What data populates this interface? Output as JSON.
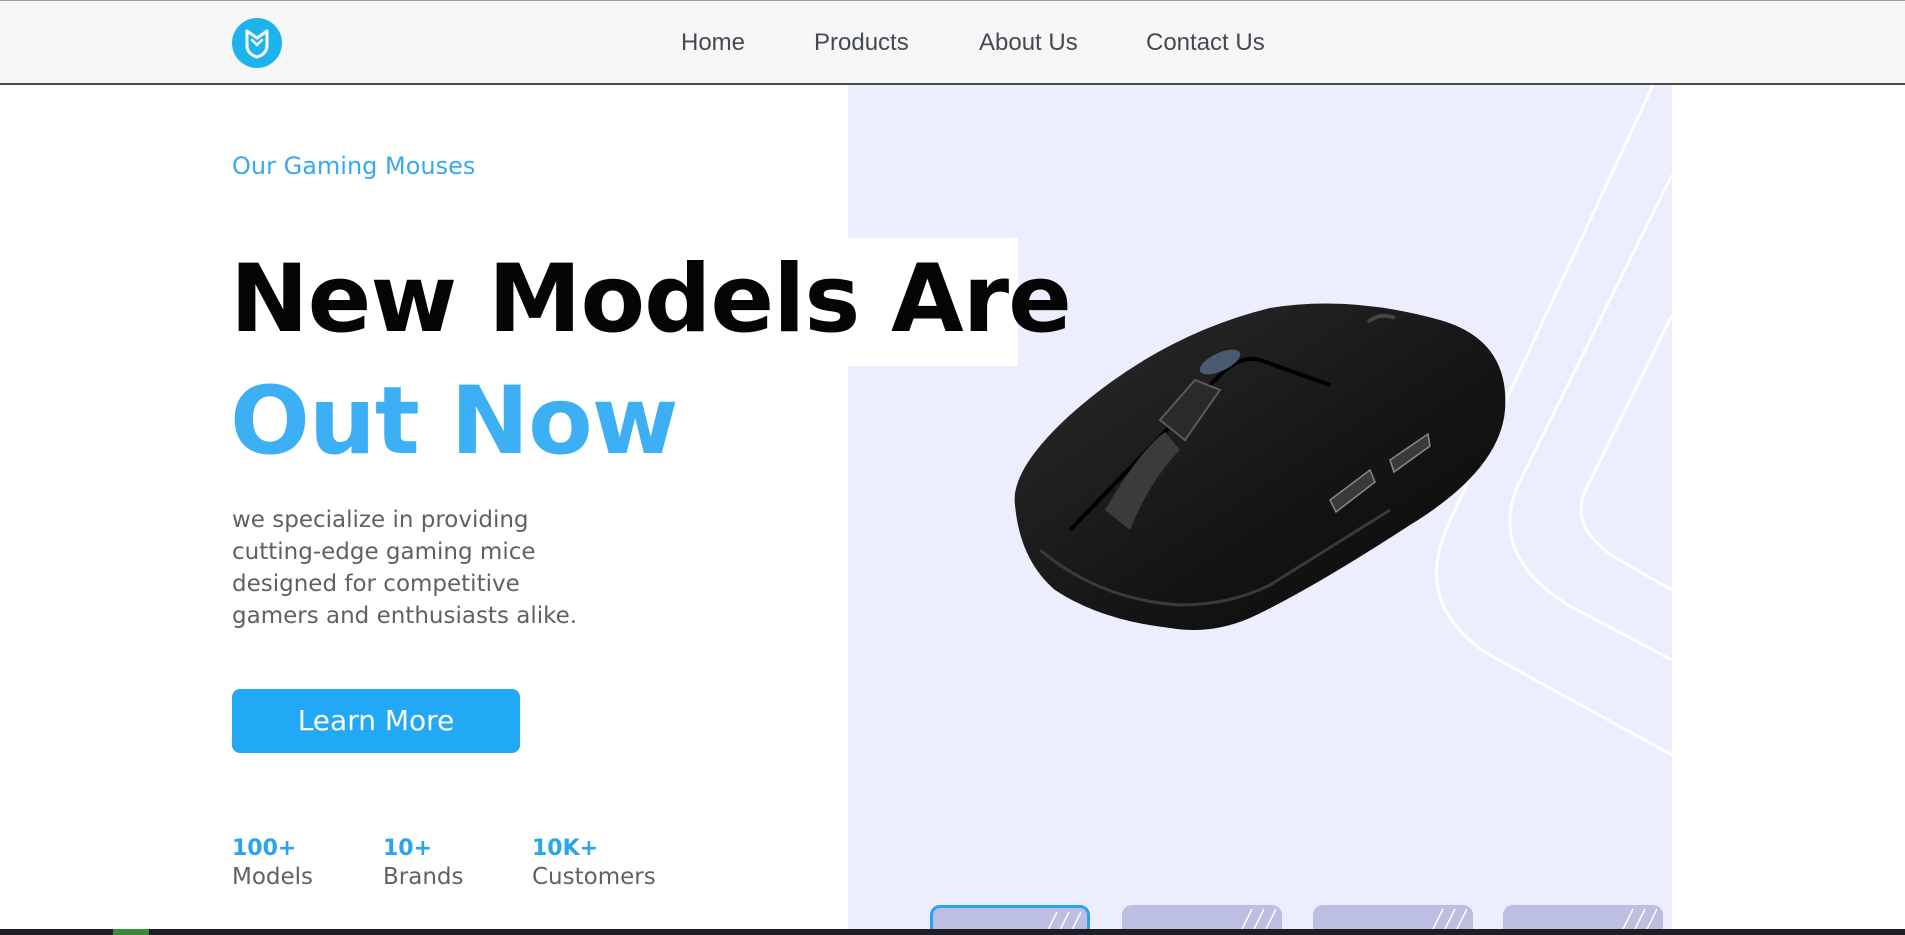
{
  "header": {
    "logo_icon": "shield-mask-logo-icon",
    "accent_color": "#1db4ee",
    "nav": [
      {
        "label": "Home"
      },
      {
        "label": "Products"
      },
      {
        "label": "About Us"
      },
      {
        "label": "Contact Us"
      }
    ]
  },
  "hero": {
    "eyebrow": "Our Gaming Mouses",
    "headline_line1": "New Models Are",
    "headline_line2": "Out Now",
    "description": "we specialize in providing cutting-edge gaming mice designed for competitive gamers and enthusiasts alike.",
    "cta_label": "Learn More",
    "product_image": "black-gaming-mouse-image",
    "highlight_color": "#3daff5",
    "panel_color": "#ecedfd"
  },
  "stats": [
    {
      "value": "100+",
      "label": "Models"
    },
    {
      "value": "10+",
      "label": "Brands"
    },
    {
      "value": "10K+",
      "label": "Customers"
    }
  ],
  "thumbnails": {
    "count": 4,
    "active_index": 0
  }
}
